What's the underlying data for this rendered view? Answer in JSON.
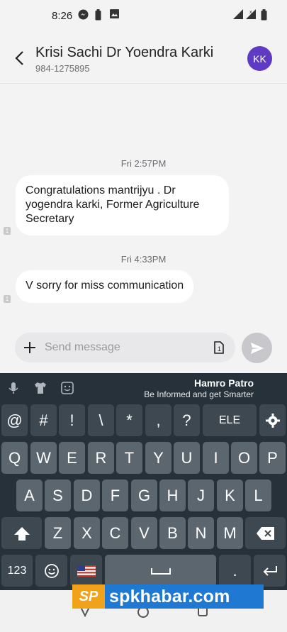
{
  "status_bar": {
    "time": "8:26",
    "icons": [
      "messenger-icon",
      "battery-saver-icon",
      "image-icon",
      "signal-icon",
      "signal-x-icon",
      "battery-icon"
    ]
  },
  "header": {
    "contact_name": "Krisi Sachi Dr Yoendra Karki",
    "phone_number": "984-1275895",
    "avatar_initials": "KK",
    "avatar_color": "#5f3bc4"
  },
  "messages": [
    {
      "timestamp": "Fri 2:57PM",
      "text": "Congratulations mantrijyu . Dr yogendra karki, Former Agriculture Secretary",
      "sim": "1"
    },
    {
      "timestamp": "Fri 4:33PM",
      "text": "V sorry for miss communication",
      "sim": "1"
    }
  ],
  "compose": {
    "placeholder": "Send message",
    "sim_label": "1"
  },
  "keyboard": {
    "ad_title": "Hamro Patro",
    "ad_subtitle": "Be Informed and get Smarter",
    "symbol_row": [
      "@",
      "#",
      "!",
      "\\",
      "*",
      ",",
      "?",
      "ELE"
    ],
    "row1": [
      "Q",
      "W",
      "E",
      "R",
      "T",
      "Y",
      "U",
      "I",
      "O",
      "P"
    ],
    "row2": [
      "A",
      "S",
      "D",
      "F",
      "G",
      "H",
      "J",
      "K",
      "L"
    ],
    "row3": [
      "Z",
      "X",
      "C",
      "V",
      "B",
      "N",
      "M"
    ],
    "numbers_key": "123",
    "period_key": "."
  },
  "watermark": {
    "logo": "SP",
    "text": "spkhabar.com"
  },
  "colors": {
    "keyboard_bg": "#263139",
    "key_bg": "#5c666e",
    "watermark_blue": "#1f78d1",
    "watermark_orange": "#f0a21a"
  }
}
